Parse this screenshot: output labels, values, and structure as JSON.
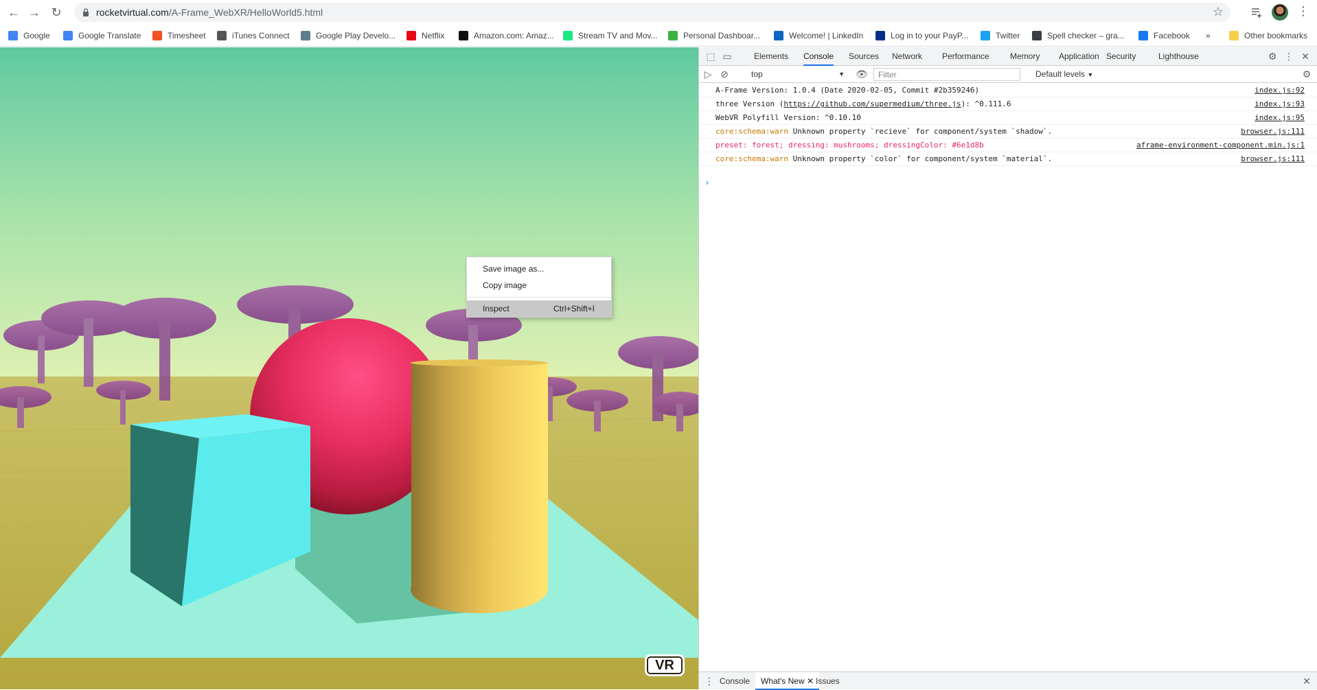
{
  "browser": {
    "url_host": "rocketvirtual.com",
    "url_path": "/A-Frame_WebXR/HelloWorld5.html",
    "bookmarks": [
      {
        "label": "Google",
        "icon": "google-icon",
        "color": "#4285f4"
      },
      {
        "label": "Google Translate",
        "icon": "translate-icon",
        "color": "#4285f4"
      },
      {
        "label": "Timesheet",
        "icon": "windows-icon",
        "color": "#f25022"
      },
      {
        "label": "iTunes Connect",
        "icon": "apple-icon",
        "color": "#555555"
      },
      {
        "label": "Google Play Develo...",
        "icon": "play-icon",
        "color": "#607d8b"
      },
      {
        "label": "Netflix",
        "icon": "netflix-icon",
        "color": "#e50914"
      },
      {
        "label": "Amazon.com: Amaz...",
        "icon": "amazon-icon",
        "color": "#111111"
      },
      {
        "label": "Stream TV and Mov...",
        "icon": "hulu-icon",
        "color": "#1ce783"
      },
      {
        "label": "Personal Dashboar...",
        "icon": "plus-icon",
        "color": "#3bb143"
      },
      {
        "label": "Welcome! | LinkedIn",
        "icon": "linkedin-icon",
        "color": "#0a66c2"
      },
      {
        "label": "Log in to your PayP...",
        "icon": "paypal-icon",
        "color": "#003087"
      },
      {
        "label": "Twitter",
        "icon": "twitter-icon",
        "color": "#1da1f2"
      },
      {
        "label": "Spell checker – gra...",
        "icon": "spellcheck-icon",
        "color": "#3c4043"
      },
      {
        "label": "Facebook",
        "icon": "facebook-icon",
        "color": "#1877f2"
      }
    ],
    "more_bookmarks": "»",
    "other_bookmarks": "Other bookmarks"
  },
  "scene": {
    "vr_label": "VR"
  },
  "context_menu": {
    "items": [
      {
        "label": "Save image as...",
        "shortcut": ""
      },
      {
        "label": "Copy image",
        "shortcut": ""
      },
      {
        "label": "Inspect",
        "shortcut": "Ctrl+Shift+I"
      }
    ]
  },
  "devtools": {
    "tabs": [
      "Elements",
      "Console",
      "Sources",
      "Network",
      "Performance",
      "Memory",
      "Application",
      "Security",
      "Lighthouse"
    ],
    "active_tab": "Console",
    "context": "top",
    "filter_placeholder": "Filter",
    "levels": "Default levels",
    "log": [
      {
        "prefix": "",
        "prefix_class": "",
        "text": "A-Frame Version: 1.0.4 (Date 2020-02-05, Commit #2b359246)",
        "link": "",
        "suffix": "",
        "source": "index.js:92"
      },
      {
        "prefix": "",
        "prefix_class": "",
        "text": "three Version (",
        "link": "https://github.com/supermedium/three.js",
        "suffix": "): ^0.111.6",
        "source": "index.js:93"
      },
      {
        "prefix": "",
        "prefix_class": "",
        "text": "WebVR Polyfill Version: ^0.10.10",
        "link": "",
        "suffix": "",
        "source": "index.js:95"
      },
      {
        "prefix": "core:schema:warn",
        "prefix_class": "warn",
        "text": " Unknown property `recieve` for component/system `shadow`.",
        "link": "",
        "suffix": "",
        "source": "browser.js:111"
      },
      {
        "prefix": "preset: forest; dressing: mushrooms; dressingColor: #6e1d8b",
        "prefix_class": "pink",
        "text": "",
        "link": "",
        "suffix": "",
        "source": "aframe-environment-component.min.js:1"
      },
      {
        "prefix": "core:schema:warn",
        "prefix_class": "warn",
        "text": " Unknown property `color` for component/system `material`.",
        "link": "",
        "suffix": "",
        "source": "browser.js:111"
      }
    ],
    "prompt": "›",
    "drawer_tabs": [
      "Console",
      "What's New",
      "Issues"
    ],
    "drawer_active": "What's New"
  }
}
